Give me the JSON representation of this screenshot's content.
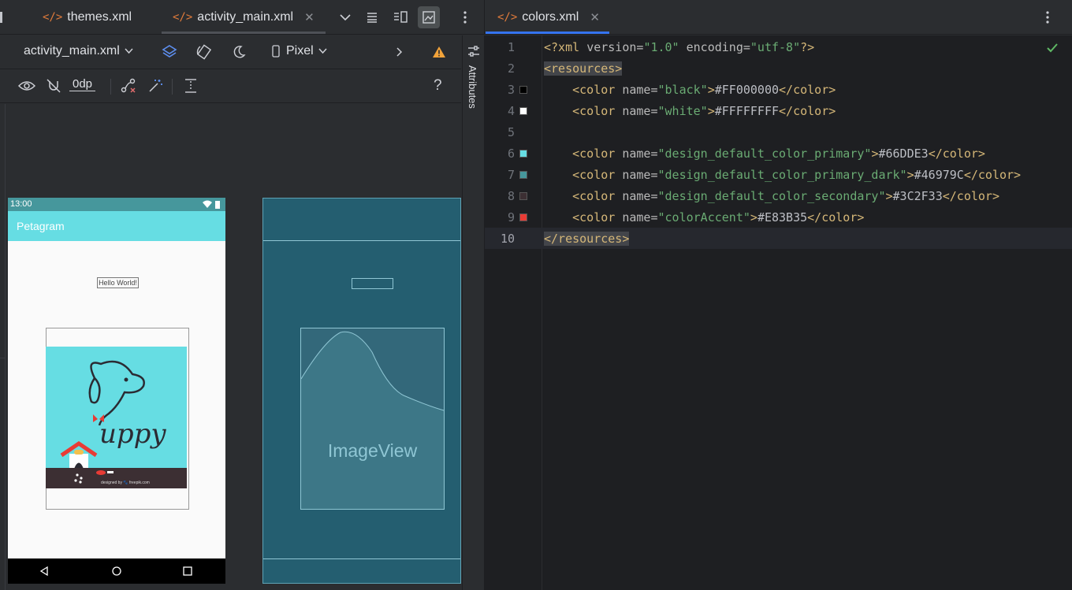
{
  "left_tabs": [
    {
      "icon": "xml-tag-icon",
      "label": "themes.xml"
    },
    {
      "icon": "xml-tag-icon",
      "label": "activity_main.xml",
      "active": true
    }
  ],
  "designer": {
    "file_select": "activity_main.xml",
    "device_select": "Pixel",
    "margin_value": "0dp",
    "help": "?",
    "attributes_label": "Attributes"
  },
  "phone": {
    "status_time": "13:00",
    "app_title": "Petagram",
    "hello_text": "Hello World!",
    "logo_text": "uppy",
    "footer_text": "designed by 🐾 freepik.com"
  },
  "blueprint": {
    "imageview_label": "ImageView"
  },
  "editor": {
    "tab": {
      "icon": "xml-tag-icon",
      "label": "colors.xml"
    },
    "lines": [
      {
        "n": "1",
        "swatch": null,
        "parts": [
          [
            "tag",
            "<?xml "
          ],
          [
            "attr",
            "version="
          ],
          [
            "str",
            "\"1.0\""
          ],
          [
            "attr",
            " encoding="
          ],
          [
            "str",
            "\"utf-8\""
          ],
          [
            "tag",
            "?>"
          ]
        ]
      },
      {
        "n": "2",
        "swatch": null,
        "parts": [
          [
            "taghl",
            "<resources>"
          ]
        ]
      },
      {
        "n": "3",
        "swatch": "#000000",
        "parts": [
          [
            "txt",
            "    "
          ],
          [
            "tag",
            "<color "
          ],
          [
            "attr",
            "name="
          ],
          [
            "str",
            "\"black\""
          ],
          [
            "tag",
            ">"
          ],
          [
            "txt",
            "#FF000000"
          ],
          [
            "tag",
            "</color>"
          ]
        ]
      },
      {
        "n": "4",
        "swatch": "#FFFFFF",
        "parts": [
          [
            "txt",
            "    "
          ],
          [
            "tag",
            "<color "
          ],
          [
            "attr",
            "name="
          ],
          [
            "str",
            "\"white\""
          ],
          [
            "tag",
            ">"
          ],
          [
            "txt",
            "#FFFFFFFF"
          ],
          [
            "tag",
            "</color>"
          ]
        ]
      },
      {
        "n": "5",
        "swatch": null,
        "parts": []
      },
      {
        "n": "6",
        "swatch": "#66DDE3",
        "parts": [
          [
            "txt",
            "    "
          ],
          [
            "tag",
            "<color "
          ],
          [
            "attr",
            "name="
          ],
          [
            "str",
            "\"design_default_color_primary\""
          ],
          [
            "tag",
            ">"
          ],
          [
            "txt",
            "#66DDE3"
          ],
          [
            "tag",
            "</color>"
          ]
        ]
      },
      {
        "n": "7",
        "swatch": "#46979C",
        "parts": [
          [
            "txt",
            "    "
          ],
          [
            "tag",
            "<color "
          ],
          [
            "attr",
            "name="
          ],
          [
            "str",
            "\"design_default_color_primary_dark\""
          ],
          [
            "tag",
            ">"
          ],
          [
            "txt",
            "#46979C"
          ],
          [
            "tag",
            "</color>"
          ]
        ]
      },
      {
        "n": "8",
        "swatch": "#3C2F33",
        "parts": [
          [
            "txt",
            "    "
          ],
          [
            "tag",
            "<color "
          ],
          [
            "attr",
            "name="
          ],
          [
            "str",
            "\"design_default_color_secondary\""
          ],
          [
            "tag",
            ">"
          ],
          [
            "txt",
            "#3C2F33"
          ],
          [
            "tag",
            "</color>"
          ]
        ]
      },
      {
        "n": "9",
        "swatch": "#E83B35",
        "parts": [
          [
            "txt",
            "    "
          ],
          [
            "tag",
            "<color "
          ],
          [
            "attr",
            "name="
          ],
          [
            "str",
            "\"colorAccent\""
          ],
          [
            "tag",
            ">"
          ],
          [
            "txt",
            "#E83B35"
          ],
          [
            "tag",
            "</color>"
          ]
        ]
      },
      {
        "n": "10",
        "swatch": null,
        "current": true,
        "parts": [
          [
            "taghl",
            "</resources>"
          ]
        ]
      }
    ]
  },
  "colors": {
    "accent_tab": "#3574f0",
    "primary": "#66DDE3",
    "primary_dark": "#46979C",
    "secondary": "#3C2F33",
    "accent": "#E83B35",
    "inspection_ok": "#5fb865",
    "warning": "#f2a33a"
  }
}
